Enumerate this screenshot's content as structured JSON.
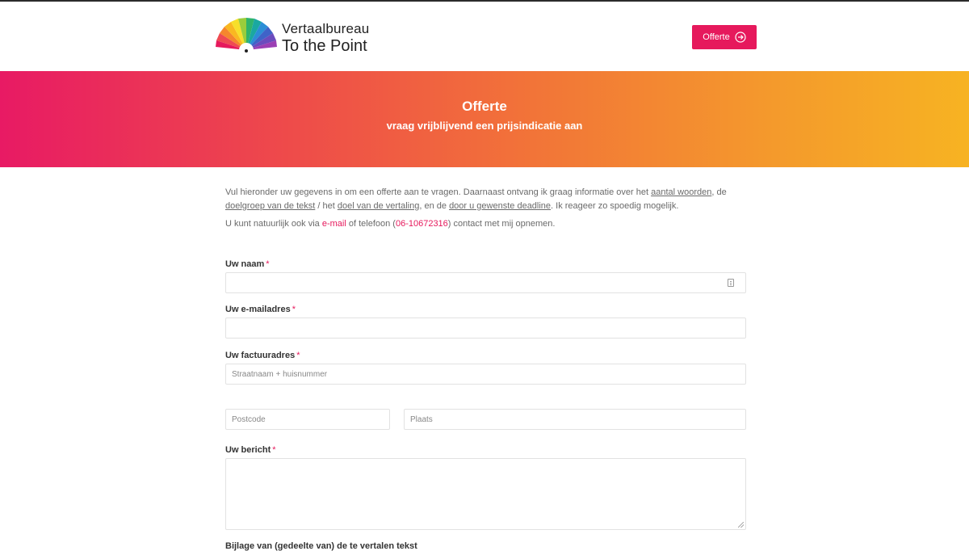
{
  "brand": {
    "line1": "Vertaalbureau",
    "line2": "To the Point",
    "logo_icon": "rainbow-fan-icon",
    "accent_color": "#e6195c"
  },
  "header": {
    "cta_label": "Offerte",
    "cta_icon": "arrow-right-circle-icon"
  },
  "banner": {
    "title": "Offerte",
    "subtitle": "vraag vrijblijvend een prijsindicatie aan",
    "gradient_start": "#e81a64",
    "gradient_end": "#f7b322"
  },
  "intro": {
    "p1_a": "Vul hieronder uw gegevens in om een offerte aan te vragen. Daarnaast ontvang ik graag informatie over het ",
    "link_words": "aantal woorden",
    "p1_b": ", de ",
    "link_audience": "doelgroep van de tekst",
    "p1_c": " / het ",
    "link_goal": "doel van de vertaling",
    "p1_d": ", en de ",
    "link_deadline": "door u gewenste deadline",
    "p1_e": ". Ik reageer zo spoedig mogelijk.",
    "p2_a": "U kunt natuurlijk ook via ",
    "link_email": "e-mail",
    "p2_b": " of telefoon (",
    "link_phone": "06-10672316",
    "p2_c": ") contact met mij opnemen."
  },
  "form": {
    "required_mark": "*",
    "name_label": "Uw naam",
    "email_label": "Uw e-mailadres",
    "address_label": "Uw factuuradres",
    "street_placeholder": "Straatnaam + huisnummer",
    "postcode_placeholder": "Postcode",
    "city_placeholder": "Plaats",
    "message_label": "Uw bericht",
    "attachment_label": "Bijlage van (gedeelte van) de te vertalen tekst"
  }
}
